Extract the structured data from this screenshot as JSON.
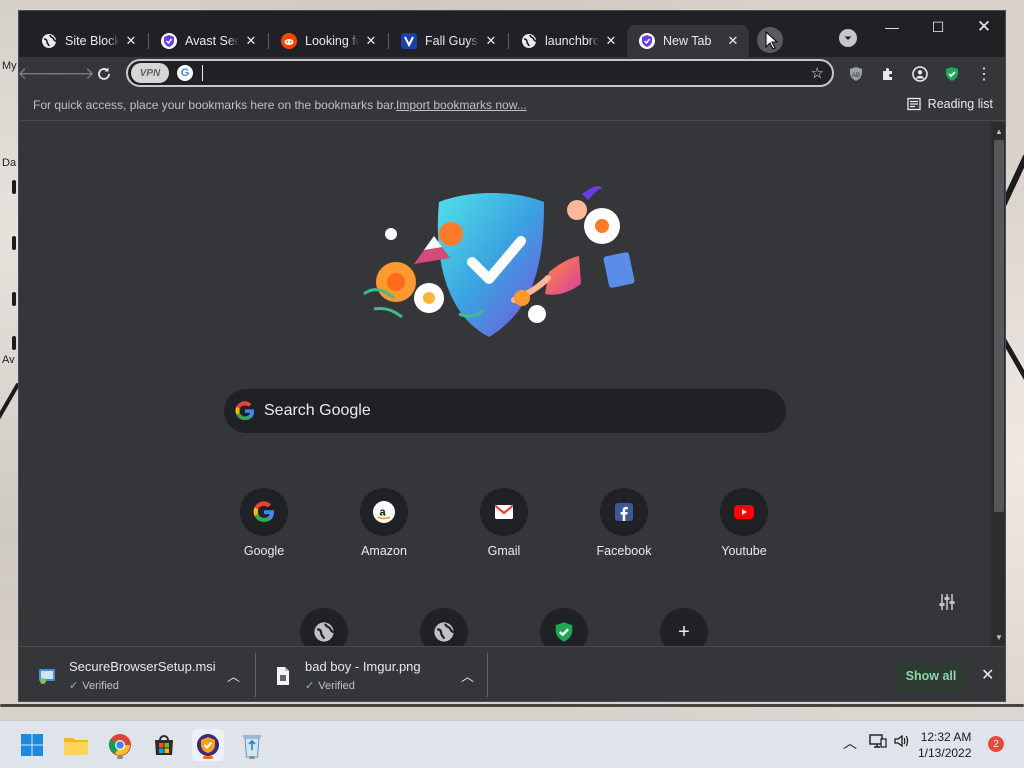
{
  "desktop": {
    "labels": [
      "My",
      "Da",
      "Av"
    ]
  },
  "tabs": [
    {
      "title": "Site Blocker",
      "icon": "globe-icon",
      "active": false
    },
    {
      "title": "Avast Secure",
      "icon": "avast-secure-browser-icon",
      "active": false
    },
    {
      "title": "Looking for",
      "icon": "reddit-icon",
      "active": false
    },
    {
      "title": "Fall Guys: Ultimate",
      "icon": "fall-guys-icon",
      "active": false
    },
    {
      "title": "launchbrowser",
      "icon": "globe-icon",
      "active": false
    },
    {
      "title": "New Tab",
      "icon": "avast-secure-browser-icon",
      "active": true
    }
  ],
  "toolbar": {
    "vpn_label": "VPN",
    "omnibox_value": "",
    "search_engine_icon": "google-icon"
  },
  "bookmarks_bar": {
    "hint": "For quick access, place your bookmarks here on the bookmarks bar.",
    "import_link": "Import bookmarks now...",
    "reading_list": "Reading list"
  },
  "newtab": {
    "search_placeholder": "Search Google",
    "shortcuts": [
      {
        "label": "Google",
        "icon": "google-icon"
      },
      {
        "label": "Amazon",
        "icon": "amazon-icon"
      },
      {
        "label": "Gmail",
        "icon": "gmail-icon"
      },
      {
        "label": "Facebook",
        "icon": "facebook-icon"
      },
      {
        "label": "Youtube",
        "icon": "youtube-icon"
      }
    ],
    "shortcuts_row2": [
      "globe-icon",
      "globe-icon",
      "avast-shield-icon",
      "add-shortcut-icon"
    ]
  },
  "downloads": {
    "items": [
      {
        "name": "SecureBrowserSetup.msi",
        "status": "Verified",
        "icon": "installer-icon"
      },
      {
        "name": "bad boy - Imgur.png",
        "status": "Verified",
        "icon": "image-file-icon"
      }
    ],
    "show_all": "Show all"
  },
  "taskbar": {
    "time": "12:32 AM",
    "date": "1/13/2022",
    "notification_count": "2",
    "apps": [
      "start-icon",
      "file-explorer-icon",
      "chrome-icon",
      "microsoft-store-icon",
      "avast-secure-browser-icon",
      "recycle-bin-icon"
    ]
  },
  "colors": {
    "browser_dark": "#35363a",
    "tabstrip": "#202124",
    "show_all_text": "#8ad9a8",
    "avast_orange": "#f26b21",
    "taskbar": "#dfe3ea"
  }
}
